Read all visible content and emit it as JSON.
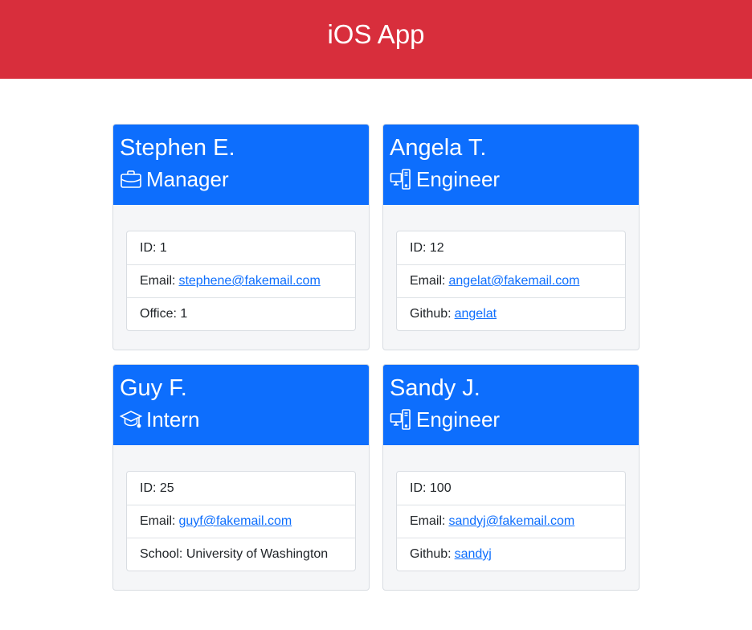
{
  "header": {
    "title": "iOS App"
  },
  "colors": {
    "header_bg": "#d82e3c",
    "card_head_bg": "#0d6efd",
    "link": "#0d6efd"
  },
  "cards": [
    {
      "name": "Stephen E.",
      "role": "Manager",
      "role_icon": "briefcase-icon",
      "id_label": "ID: 1",
      "email_prefix": "Email:",
      "email": "stephene@fakemail.com",
      "extra_prefix": "Office:",
      "extra_value": "1"
    },
    {
      "name": "Angela T.",
      "role": "Engineer",
      "role_icon": "pc-display-icon",
      "id_label": "ID: 12",
      "email_prefix": "Email:",
      "email": "angelat@fakemail.com",
      "extra_prefix": "Github:",
      "extra_value": "angelat"
    },
    {
      "name": "Guy F.",
      "role": "Intern",
      "role_icon": "mortarboard-icon",
      "id_label": "ID: 25",
      "email_prefix": "Email:",
      "email": "guyf@fakemail.com",
      "extra_prefix": "School:",
      "extra_value": "University of Washington"
    },
    {
      "name": "Sandy J.",
      "role": "Engineer",
      "role_icon": "pc-display-icon",
      "id_label": "ID: 100",
      "email_prefix": "Email:",
      "email": "sandyj@fakemail.com",
      "extra_prefix": "Github:",
      "extra_value": "sandyj"
    }
  ]
}
